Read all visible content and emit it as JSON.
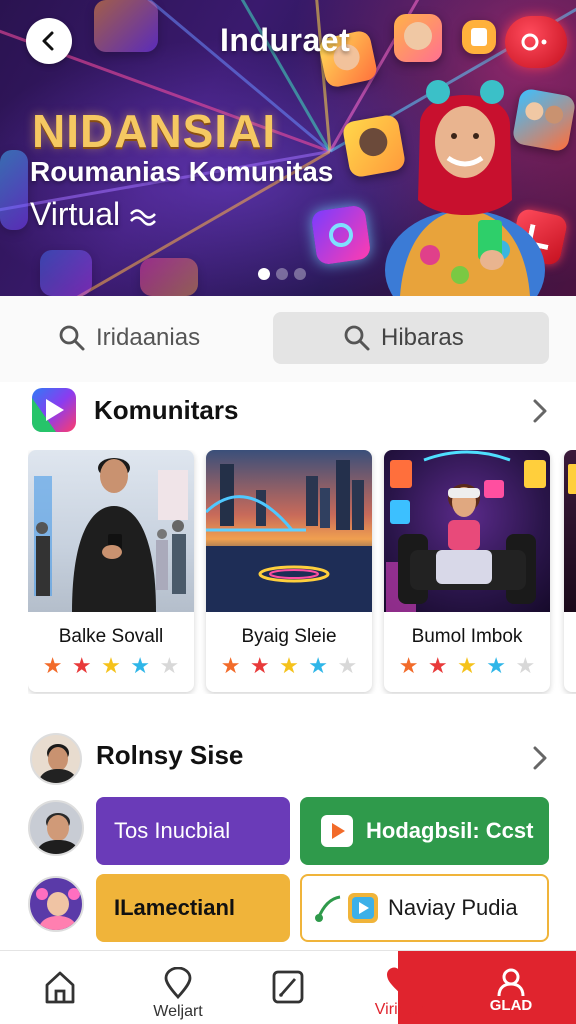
{
  "hero": {
    "title": "Induraet",
    "badge": "NIDANSIAI",
    "subtitle": "Roumanias Komunitas",
    "virtual_label": "Virtual",
    "carousel": {
      "count": 3,
      "active": 0
    }
  },
  "search_tabs": [
    {
      "label": "Iridaanias",
      "icon": "search-icon"
    },
    {
      "label": "Hibaras",
      "icon": "search-icon"
    }
  ],
  "komunitas": {
    "title": "Komunitars",
    "cards": [
      {
        "title": "Balke Sovall",
        "rating": 4
      },
      {
        "title": "Byaig Sleie",
        "rating": 4
      },
      {
        "title": "Bumol Imbok",
        "rating": 4
      }
    ]
  },
  "second_section": {
    "title": "Rolnsy Sise",
    "tiles": [
      {
        "label": "Tos Inucbial",
        "color": "#6a3bb8"
      },
      {
        "label": "Hodagbsil: Ccst",
        "color": "#2f9a4b"
      },
      {
        "label": "ILamectianl",
        "color": "#f0b43a"
      },
      {
        "label": "Naviay Pudia",
        "color": "#ffffff"
      }
    ]
  },
  "bottom_nav": {
    "items": [
      {
        "label": "",
        "icon": "home-icon"
      },
      {
        "label": "Weljart",
        "icon": "location-icon"
      },
      {
        "label": "",
        "icon": "edit-icon"
      },
      {
        "label": "Virintar",
        "icon": "heart-icon"
      }
    ],
    "cta": {
      "label": "GLAD",
      "icon": "user-icon"
    }
  },
  "colors": {
    "accent_red": "#e0242e",
    "star_orange": "#f26b2a",
    "star_red": "#e83a3a",
    "star_yellow": "#f5c21b",
    "star_blue": "#2fb6e8",
    "star_empty": "#d8d8d8"
  }
}
